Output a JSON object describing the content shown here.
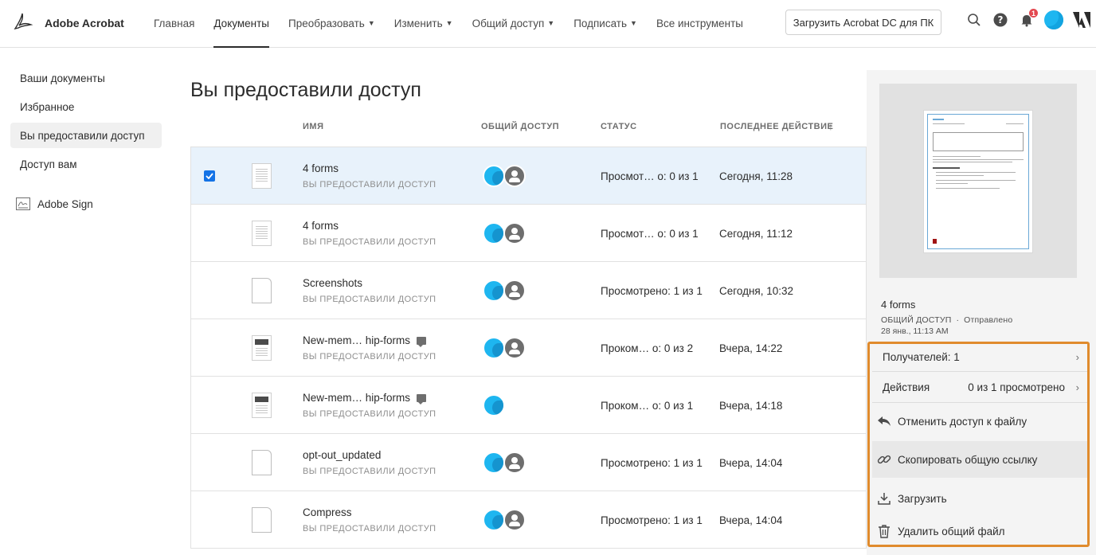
{
  "header": {
    "brand": "Adobe Acrobat",
    "nav": [
      {
        "label": "Главная",
        "dropdown": false
      },
      {
        "label": "Документы",
        "dropdown": false,
        "active": true
      },
      {
        "label": "Преобразовать",
        "dropdown": true
      },
      {
        "label": "Изменить",
        "dropdown": true
      },
      {
        "label": "Общий доступ",
        "dropdown": true
      },
      {
        "label": "Подписать",
        "dropdown": true
      },
      {
        "label": "Все инструменты",
        "dropdown": false
      }
    ],
    "cta": "Загрузить Acrobat DC для ПК",
    "notification_count": "1",
    "icons": [
      "search-icon",
      "help-icon",
      "bell-icon",
      "avatar",
      "adobe-logo-icon"
    ]
  },
  "sidebar": {
    "items": [
      {
        "label": "Ваши документы"
      },
      {
        "label": "Избранное"
      },
      {
        "label": "Вы предоставили доступ",
        "active": true
      },
      {
        "label": "Доступ вам"
      }
    ],
    "sign": "Adobe Sign"
  },
  "main": {
    "title": "Вы предоставили доступ",
    "columns": {
      "name": "ИМЯ",
      "shared": "ОБЩИЙ ДОСТУП",
      "status": "СТАТУС",
      "last": "ПОСЛЕДНЕЕ ДЕЙСТВИЕ"
    },
    "rows": [
      {
        "name": "4 forms",
        "sub": "ВЫ ПРЕДОСТАВИЛИ ДОСТУП",
        "status": "Просмот… о: 0 из 1",
        "last": "Сегодня, 11:28",
        "selected": true,
        "thumb": "doc",
        "avatars": 2,
        "comment": false
      },
      {
        "name": "4 forms",
        "sub": "ВЫ ПРЕДОСТАВИЛИ ДОСТУП",
        "status": "Просмот… о: 0 из 1",
        "last": "Сегодня, 11:12",
        "selected": false,
        "thumb": "doc",
        "avatars": 2,
        "comment": false
      },
      {
        "name": "Screenshots",
        "sub": "ВЫ ПРЕДОСТАВИЛИ ДОСТУП",
        "status": "Просмотрено: 1 из 1",
        "last": "Сегодня, 10:32",
        "selected": false,
        "thumb": "blank",
        "avatars": 2,
        "comment": false
      },
      {
        "name": "New-mem… hip-forms",
        "sub": "ВЫ ПРЕДОСТАВИЛИ ДОСТУП",
        "status": "Проком… о: 0 из 2",
        "last": "Вчера, 14:22",
        "selected": false,
        "thumb": "dark",
        "avatars": 2,
        "comment": true
      },
      {
        "name": "New-mem… hip-forms",
        "sub": "ВЫ ПРЕДОСТАВИЛИ ДОСТУП",
        "status": "Проком… о: 0 из 1",
        "last": "Вчера, 14:18",
        "selected": false,
        "thumb": "dark",
        "avatars": 1,
        "comment": true
      },
      {
        "name": "opt-out_updated",
        "sub": "ВЫ ПРЕДОСТАВИЛИ ДОСТУП",
        "status": "Просмотрено: 1 из 1",
        "last": "Вчера, 14:04",
        "selected": false,
        "thumb": "blank",
        "avatars": 2,
        "comment": false
      },
      {
        "name": "Compress",
        "sub": "ВЫ ПРЕДОСТАВИЛИ ДОСТУП",
        "status": "Просмотрено: 1 из 1",
        "last": "Вчера, 14:04",
        "selected": false,
        "thumb": "blank",
        "avatars": 2,
        "comment": false
      }
    ]
  },
  "panel": {
    "file_name": "4 forms",
    "meta_type": "ОБЩИЙ ДОСТУП",
    "meta_state": "Отправлено",
    "date": "28 янв., 11:13 AM",
    "recipients_label": "Получателей: 1",
    "actions_label": "Действия",
    "actions_value": "0 из 1 просмотрено",
    "unshare": "Отменить доступ к файлу",
    "copy_link": "Скопировать общую ссылку",
    "download": "Загрузить",
    "delete": "Удалить общий файл",
    "highlight_color": "#e08b2d"
  }
}
